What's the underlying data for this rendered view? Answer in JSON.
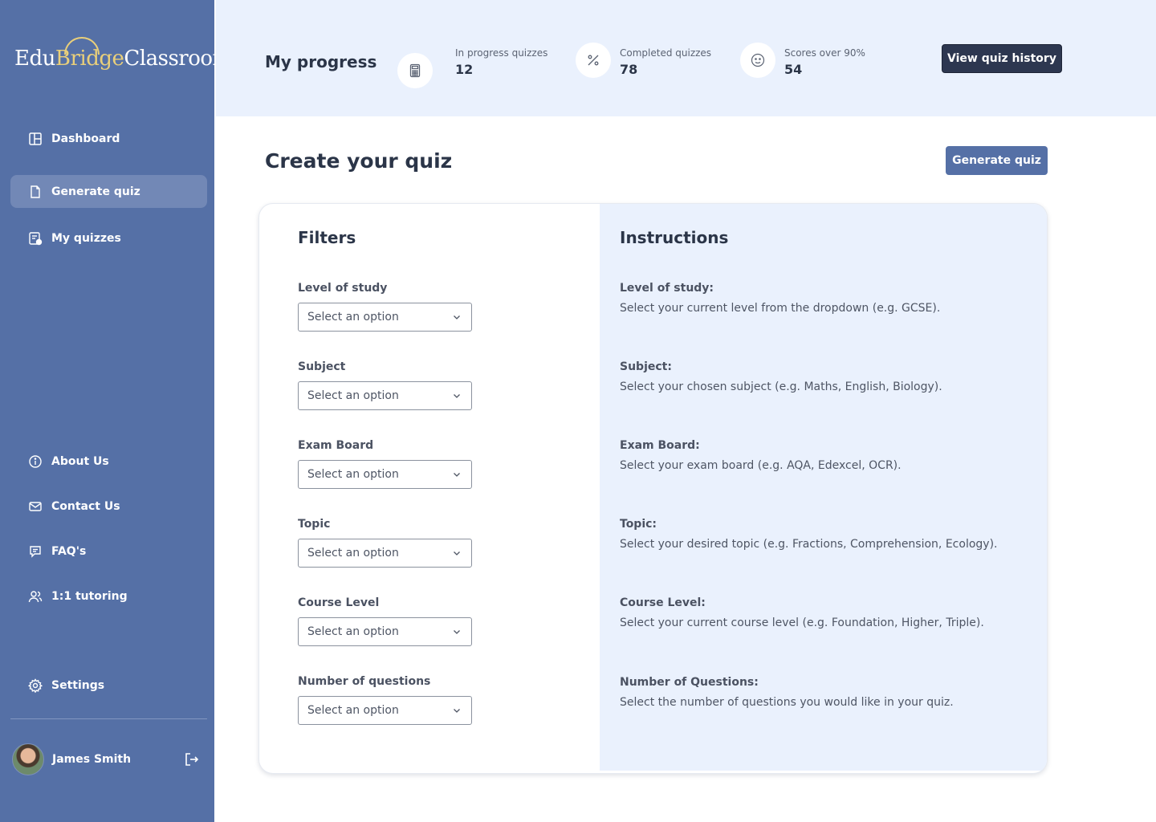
{
  "brand": {
    "part1": "Edu",
    "part2": "Bridge",
    "part3": "Classroom"
  },
  "sidebar": {
    "nav_top": [
      {
        "label": "Dashboard",
        "icon": "layout-icon"
      },
      {
        "label": "Generate quiz",
        "icon": "file-icon",
        "active": true
      },
      {
        "label": "My quizzes",
        "icon": "quiz-icon"
      }
    ],
    "nav_bottom": [
      {
        "label": "About Us",
        "icon": "info-icon"
      },
      {
        "label": "Contact Us",
        "icon": "mail-icon"
      },
      {
        "label": "FAQ's",
        "icon": "chat-icon"
      },
      {
        "label": "1:1 tutoring",
        "icon": "users-icon"
      }
    ],
    "settings": {
      "label": "Settings",
      "icon": "gear-icon"
    },
    "user": {
      "name": "James Smith"
    }
  },
  "progress": {
    "title": "My progress",
    "stats": [
      {
        "label": "In progress quizzes",
        "value": "12",
        "icon": "calculator-icon"
      },
      {
        "label": "Completed quizzes",
        "value": "78",
        "icon": "percent-icon"
      },
      {
        "label": "Scores over 90%",
        "value": "54",
        "icon": "smiley-icon"
      }
    ],
    "history_button": "View quiz history"
  },
  "main": {
    "title": "Create your quiz",
    "generate_button": "Generate quiz",
    "filters_heading": "Filters",
    "instructions_heading": "Instructions",
    "filters": [
      {
        "label": "Level of study",
        "placeholder": "Select an option"
      },
      {
        "label": "Subject",
        "placeholder": "Select an option"
      },
      {
        "label": "Exam Board",
        "placeholder": "Select an option"
      },
      {
        "label": "Topic",
        "placeholder": "Select an option"
      },
      {
        "label": "Course Level",
        "placeholder": "Select an option"
      },
      {
        "label": "Number of questions",
        "placeholder": "Select an option"
      }
    ],
    "instructions": [
      {
        "title": "Level of study:",
        "text": "Select your current level from the dropdown (e.g. GCSE)."
      },
      {
        "title": "Subject:",
        "text": "Select your chosen subject (e.g. Maths, English, Biology)."
      },
      {
        "title": "Exam Board:",
        "text": "Select your exam board (e.g. AQA, Edexcel, OCR)."
      },
      {
        "title": "Topic:",
        "text": "Select your desired topic (e.g. Fractions, Comprehension, Ecology)."
      },
      {
        "title": "Course Level:",
        "text": "Select your current course level (e.g. Foundation, Higher, Triple)."
      },
      {
        "title": "Number of Questions:",
        "text": "Select the number of questions you would like in your quiz."
      }
    ]
  },
  "colors": {
    "sidebar": "#5570a6",
    "accent_bg": "#eaf1fd",
    "dark_button": "#2d3750",
    "logo_gold": "#e9cf7a"
  }
}
